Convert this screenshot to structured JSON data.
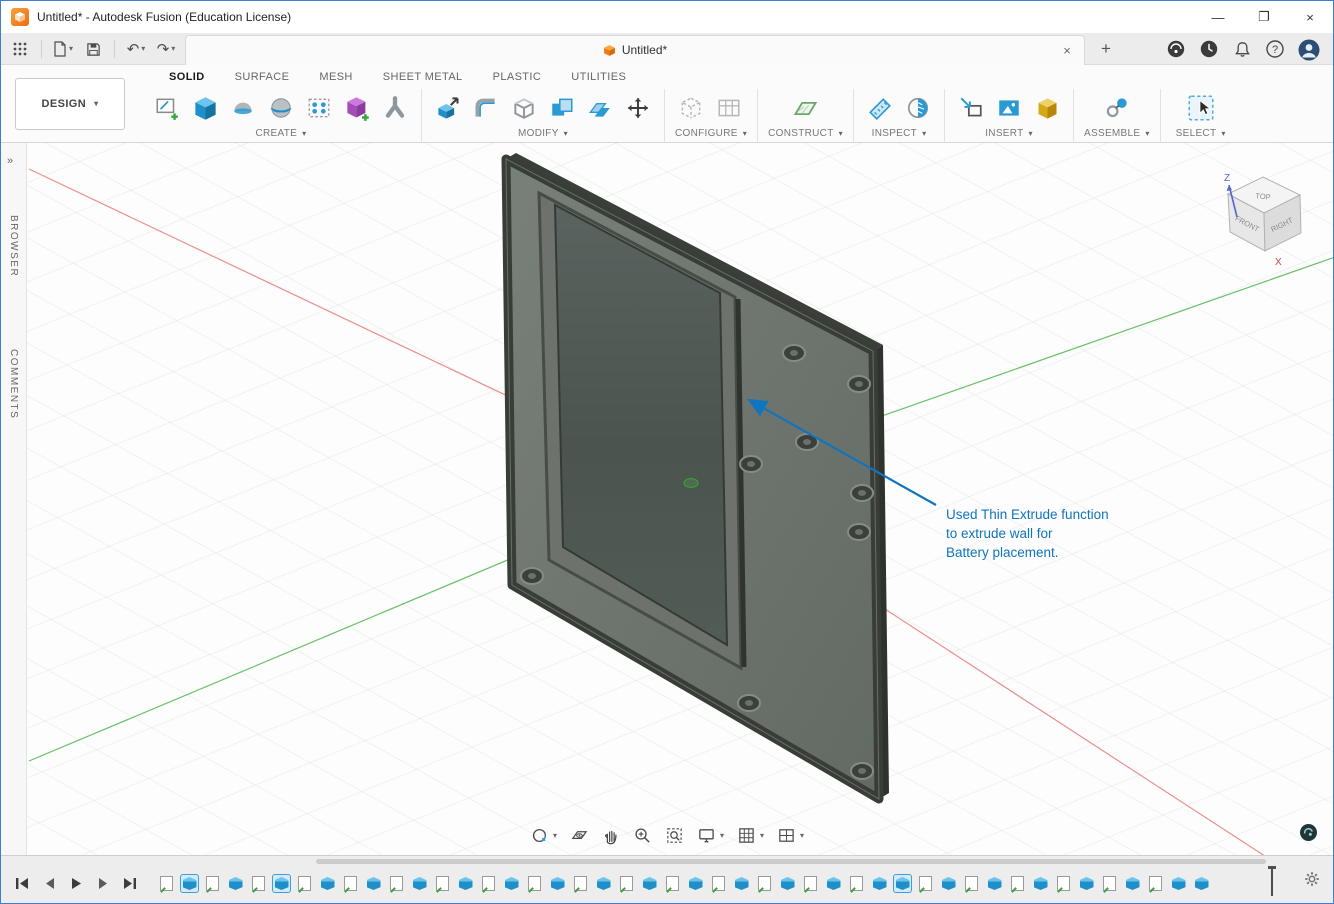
{
  "window": {
    "title": "Untitled* - Autodesk Fusion (Education License)",
    "controls": {
      "minimize": "—",
      "maximize": "❐",
      "close": "×"
    }
  },
  "icons": {
    "caret": "▾",
    "collapse": "»",
    "new_tab": "+",
    "help_glyph": "?"
  },
  "quickbar": {
    "document_tab": {
      "title": "Untitled*",
      "close": "×"
    }
  },
  "ribbon": {
    "design_label": "DESIGN",
    "tabs": [
      {
        "label": "SOLID",
        "active": true
      },
      {
        "label": "SURFACE"
      },
      {
        "label": "MESH"
      },
      {
        "label": "SHEET METAL"
      },
      {
        "label": "PLASTIC"
      },
      {
        "label": "UTILITIES"
      }
    ],
    "groups": [
      {
        "label": "CREATE"
      },
      {
        "label": "MODIFY"
      },
      {
        "label": "CONFIGURE"
      },
      {
        "label": "CONSTRUCT"
      },
      {
        "label": "INSPECT"
      },
      {
        "label": "INSERT"
      },
      {
        "label": "ASSEMBLE"
      },
      {
        "label": "SELECT"
      }
    ]
  },
  "side_panels": {
    "browser": "BROWSER",
    "comments": "COMMENTS"
  },
  "viewcube": {
    "top": "TOP",
    "front": "FRONT",
    "right": "RIGHT",
    "z_axis": "Z",
    "x_axis": "X"
  },
  "annotation": {
    "line1": "Used Thin Extrude function",
    "line2": "to extrude wall for",
    "line3": "Battery placement.",
    "color": "#1074bf"
  },
  "colors": {
    "accent_blue": "#0696d7",
    "axis_red": "#e46a6a",
    "axis_green": "#43b043",
    "model_dark": "#383d38",
    "model_face": "#6e756f"
  },
  "timeline": {
    "items": [
      {
        "type": "sketch"
      },
      {
        "type": "extrude",
        "selected": true
      },
      {
        "type": "sketch"
      },
      {
        "type": "extrude"
      },
      {
        "type": "sketch"
      },
      {
        "type": "extrude",
        "selected": true
      },
      {
        "type": "sketch"
      },
      {
        "type": "extrude"
      },
      {
        "type": "sketch"
      },
      {
        "type": "extrude"
      },
      {
        "type": "sketch"
      },
      {
        "type": "extrude"
      },
      {
        "type": "sketch"
      },
      {
        "type": "extrude"
      },
      {
        "type": "sketch"
      },
      {
        "type": "extrude"
      },
      {
        "type": "sketch"
      },
      {
        "type": "extrude"
      },
      {
        "type": "sketch"
      },
      {
        "type": "extrude"
      },
      {
        "type": "sketch"
      },
      {
        "type": "extrude"
      },
      {
        "type": "sketch"
      },
      {
        "type": "extrude"
      },
      {
        "type": "sketch"
      },
      {
        "type": "extrude"
      },
      {
        "type": "sketch"
      },
      {
        "type": "extrude"
      },
      {
        "type": "sketch"
      },
      {
        "type": "extrude"
      },
      {
        "type": "sketch"
      },
      {
        "type": "extrude"
      },
      {
        "type": "extrude",
        "selected": true
      },
      {
        "type": "sketch"
      },
      {
        "type": "extrude"
      },
      {
        "type": "sketch"
      },
      {
        "type": "extrude"
      },
      {
        "type": "sketch"
      },
      {
        "type": "extrude"
      },
      {
        "type": "sketch"
      },
      {
        "type": "extrude"
      },
      {
        "type": "sketch"
      },
      {
        "type": "extrude"
      },
      {
        "type": "sketch"
      },
      {
        "type": "extrude"
      },
      {
        "type": "extrude"
      }
    ]
  }
}
